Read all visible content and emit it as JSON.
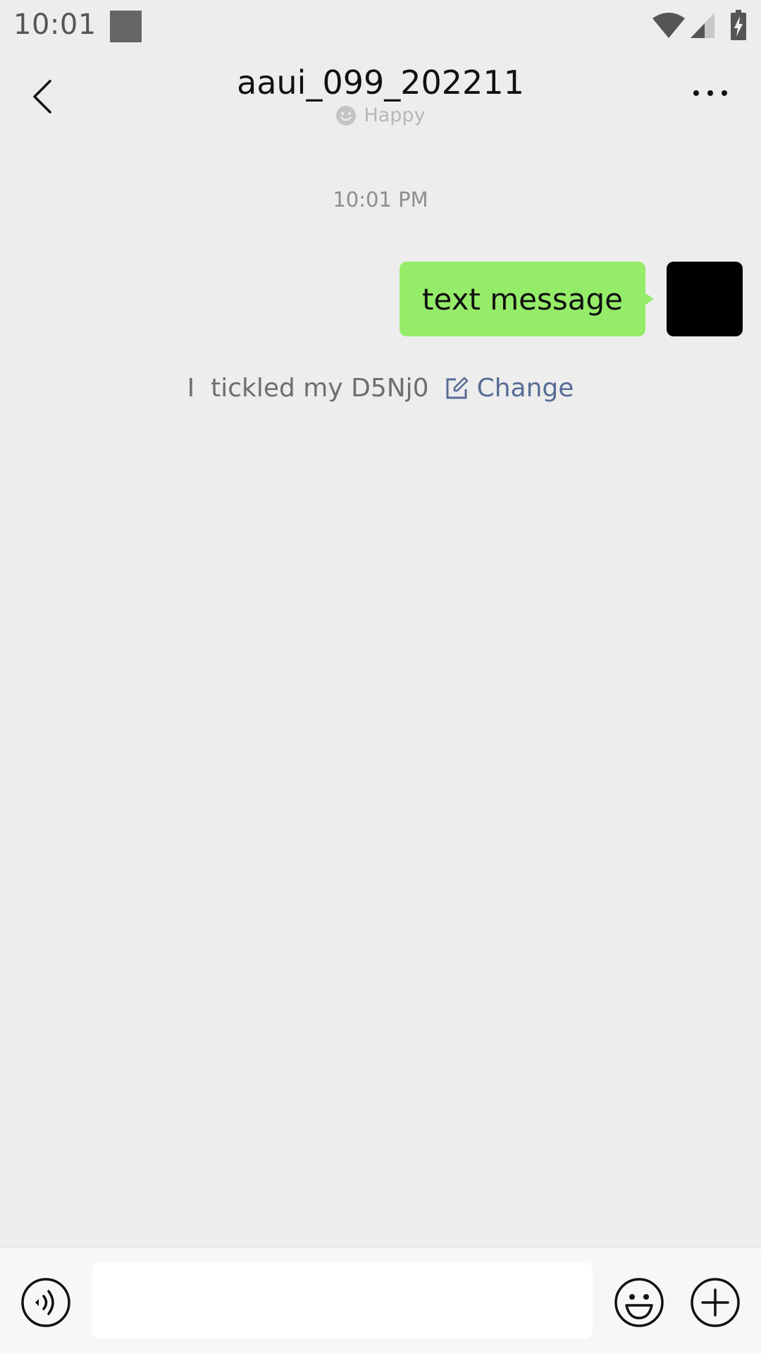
{
  "status_bar": {
    "time": "10:01",
    "icons": [
      "notification-square-icon",
      "wifi-icon",
      "cell-signal-icon",
      "battery-charging-icon"
    ]
  },
  "header": {
    "title": "aaui_099_202211",
    "status_text": "Happy",
    "icons": [
      "back-arrow-icon",
      "mood-face-icon",
      "more-dots-icon"
    ]
  },
  "chat": {
    "timestamp": "10:01 PM",
    "messages": [
      {
        "sender": "self",
        "text": "text message"
      }
    ],
    "tickle": {
      "text": "I  tickled my D5Nj0",
      "change_label": "Change"
    }
  },
  "input_bar": {
    "input_value": "",
    "icons": [
      "voice-icon",
      "emoji-icon",
      "plus-icon"
    ]
  },
  "colors": {
    "background": "#EDEDED",
    "bubble": "#95EC69",
    "link": "#576B95",
    "avatar": "#000000"
  }
}
